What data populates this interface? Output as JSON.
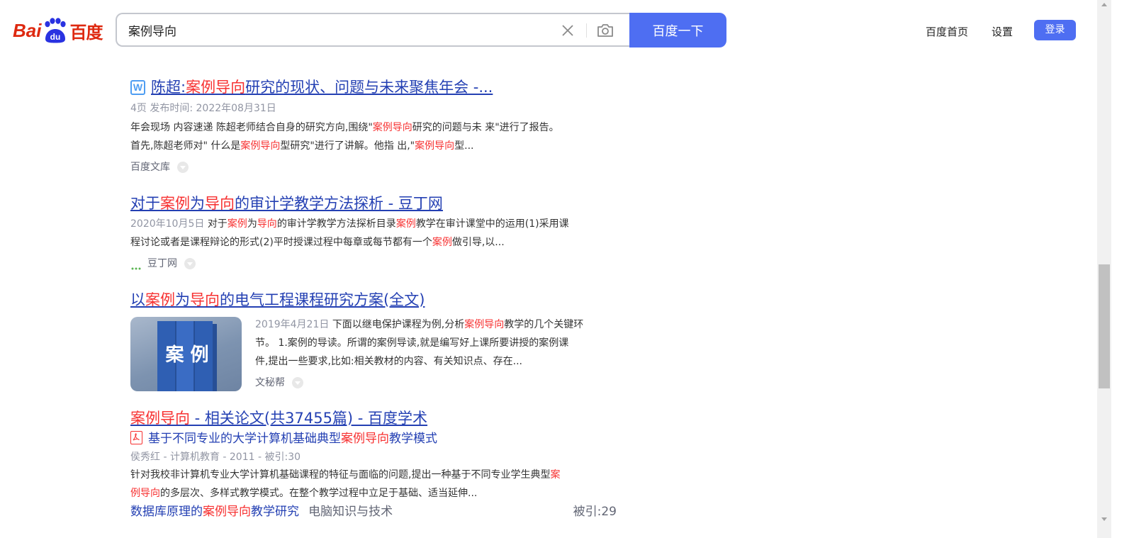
{
  "header": {
    "logo": {
      "bai": "Bai",
      "du": "du",
      "cn": "百度"
    },
    "search": {
      "value": "案例导向"
    },
    "search_button": "百度一下",
    "links": {
      "home": "百度首页",
      "settings": "设置"
    },
    "login": "登录"
  },
  "results": [
    {
      "title_parts": [
        {
          "text": "陈超:",
          "hl": false
        },
        {
          "text": "案例导向",
          "hl": true
        },
        {
          "text": "研究的现状、问题与未来聚焦年会 -...",
          "hl": false
        }
      ],
      "doc_icon": "W",
      "meta": "4页 发布时间: 2022年08月31日",
      "abstract_line1_parts": [
        {
          "text": "年会现场 内容速递 陈超老师结合自身的研究方向,围绕\"",
          "hl": false
        },
        {
          "text": "案例导向",
          "hl": true
        },
        {
          "text": "研究的问题与未 来\"进行了报告。",
          "hl": false
        }
      ],
      "abstract_line2_parts": [
        {
          "text": "首先,陈超老师对\" 什么是",
          "hl": false
        },
        {
          "text": "案例导向",
          "hl": true
        },
        {
          "text": "型研究\"进行了讲解。他指 出,\"",
          "hl": false
        },
        {
          "text": "案例导向",
          "hl": true
        },
        {
          "text": "型...",
          "hl": false
        }
      ],
      "source": "百度文库"
    },
    {
      "title_parts": [
        {
          "text": "对于",
          "hl": false
        },
        {
          "text": "案例",
          "hl": true
        },
        {
          "text": "为",
          "hl": false
        },
        {
          "text": "导向",
          "hl": true
        },
        {
          "text": "的审计学教学方法探析 - 豆丁网",
          "hl": false
        }
      ],
      "date": "2020年10月5日",
      "abstract_line1_parts": [
        {
          "text": "对于",
          "hl": false
        },
        {
          "text": "案例",
          "hl": true
        },
        {
          "text": "为",
          "hl": false
        },
        {
          "text": "导向",
          "hl": true
        },
        {
          "text": "的审计学教学方法探析目录",
          "hl": false
        },
        {
          "text": "案例",
          "hl": true
        },
        {
          "text": "教学在审计课堂中的运用(1)采用课",
          "hl": false
        }
      ],
      "abstract_line2_parts": [
        {
          "text": "程讨论或者是课程辩论的形式(2)平时授课过程中每章或每节都有一个",
          "hl": false
        },
        {
          "text": "案例",
          "hl": true
        },
        {
          "text": "做引导,以...",
          "hl": false
        }
      ],
      "source": "豆丁网"
    },
    {
      "title_parts": [
        {
          "text": "以",
          "hl": false
        },
        {
          "text": "案例",
          "hl": true
        },
        {
          "text": "为",
          "hl": false
        },
        {
          "text": "导向",
          "hl": true
        },
        {
          "text": "的电气工程课程研究方案(全文)",
          "hl": false
        }
      ],
      "thumb_text": "案 例",
      "date": "2019年4月21日",
      "abstract_line1_parts": [
        {
          "text": "下面以继电保护课程为例,分析",
          "hl": false
        },
        {
          "text": "案例导向",
          "hl": true
        },
        {
          "text": "教学的几个关键环",
          "hl": false
        }
      ],
      "abstract_line2": "节。 1.案例的导读。所谓的案例导读,就是编写好上课所要讲授的案例课",
      "abstract_line3": "件,提出一些要求,比如:相关教材的内容、有关知识点、存在...",
      "source": "文秘帮"
    },
    {
      "title_parts": [
        {
          "text": "案例导向",
          "hl": true
        },
        {
          "text": " - 相关论文(共37455篇) - 百度学术",
          "hl": false
        }
      ],
      "paper_title_parts": [
        {
          "text": "基于不同专业的大学计算机基础典型",
          "hl": false
        },
        {
          "text": "案例导向",
          "hl": true
        },
        {
          "text": "教学模式",
          "hl": false
        }
      ],
      "paper_meta": "侯秀红 - 计算机教育 - 2011 - 被引:30",
      "abstract_line1_parts": [
        {
          "text": "针对我校非计算机专业大学计算机基础课程的特征与面临的问题,提出一种基于不同专业学生典型",
          "hl": false
        },
        {
          "text": "案",
          "hl": true
        }
      ],
      "abstract_line2_parts": [
        {
          "text": "例导向",
          "hl": true
        },
        {
          "text": "的多层次、多样式教学模式。在整个教学过程中立足于基础、适当延伸...",
          "hl": false
        }
      ],
      "next_paper_parts": [
        {
          "text": "数据库原理的",
          "hl": false
        },
        {
          "text": "案例导向",
          "hl": true
        },
        {
          "text": "教学研究",
          "hl": false
        }
      ],
      "next_paper_journal": "电脑知识与技术",
      "next_paper_cited": "被引:29"
    }
  ]
}
